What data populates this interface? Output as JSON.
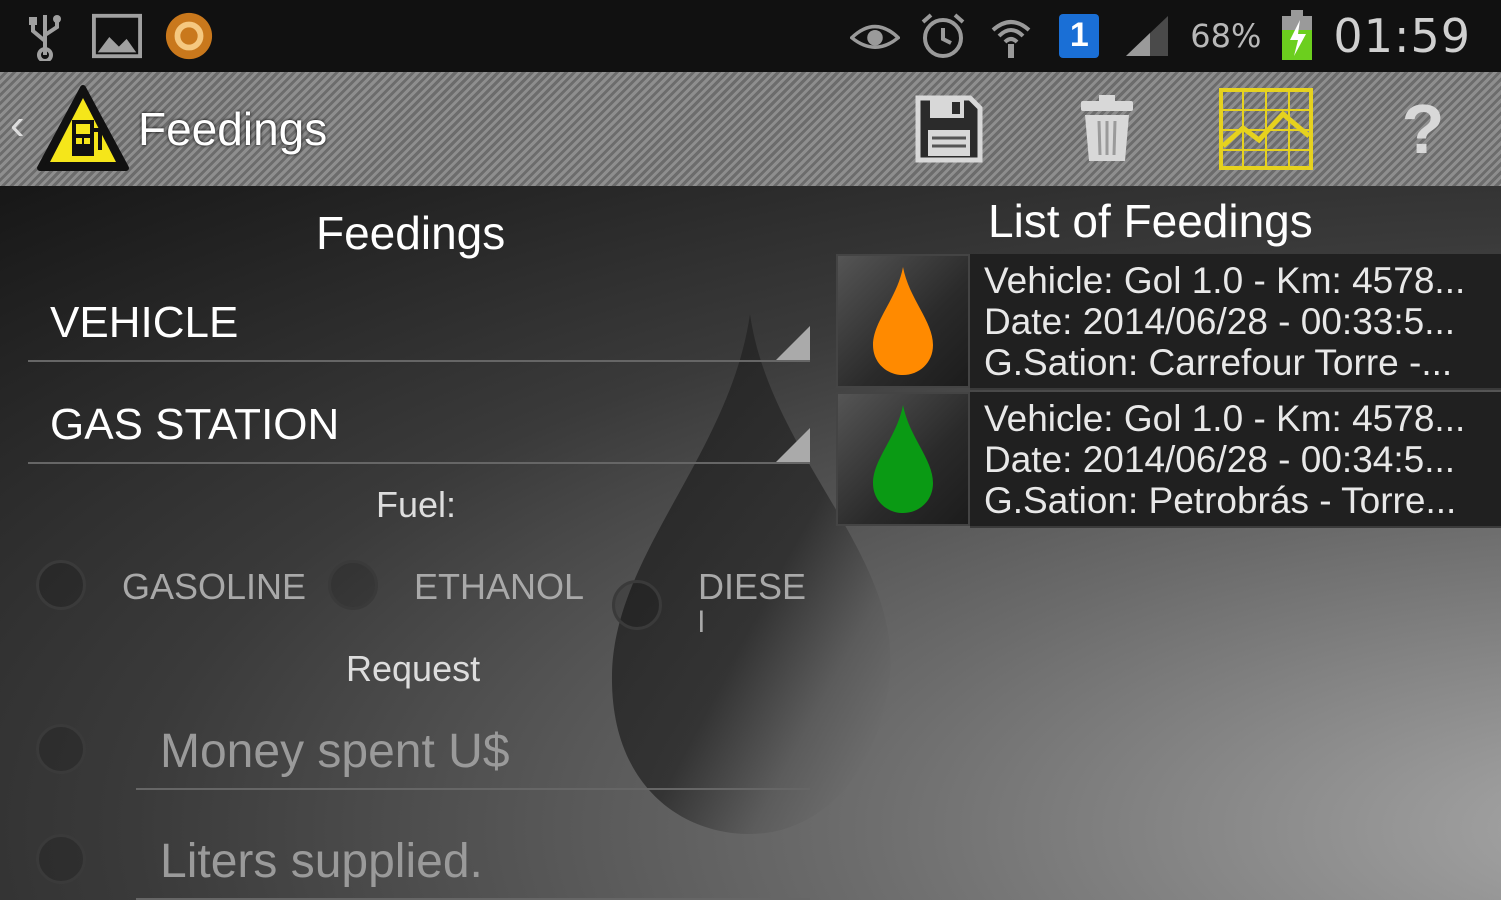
{
  "status_bar": {
    "left_icons": [
      "usb-icon",
      "picture-icon",
      "app-notification-icon"
    ],
    "right_icons": [
      "eye-icon",
      "alarm-icon",
      "wifi-icon",
      "notification-one-icon",
      "signal-icon",
      "battery-charging-icon"
    ],
    "notification_count": "1",
    "battery": "68%",
    "clock": "01:59"
  },
  "action_bar": {
    "title": "Feedings",
    "actions": [
      "save-icon",
      "trash-icon",
      "chart-icon",
      "help-icon"
    ],
    "help_glyph": "?",
    "chart_color": "#e6d21e"
  },
  "form": {
    "title": "Feedings",
    "vehicle_label": "VEHICLE",
    "gas_station_label": "GAS STATION",
    "fuel_label": "Fuel:",
    "fuel_options": [
      "GASOLINE",
      "ETHANOL",
      "DIESE"
    ],
    "diesel_wrap": "l",
    "request_label": "Request",
    "money_placeholder": "Money spent U$",
    "liters_placeholder": "Liters supplied."
  },
  "list": {
    "title": "List of Feedings",
    "items": [
      {
        "line1": "Vehicle: Gol 1.0 - Km: 4578...",
        "line2": "Date: 2014/06/28 - 00:33:5...",
        "line3": "G.Sation: Carrefour Torre -...",
        "drop_color": "#ff8a00"
      },
      {
        "line1": "Vehicle: Gol 1.0 - Km: 4578...",
        "line2": "Date: 2014/06/28 - 00:34:5...",
        "line3": "G.Sation: Petrobrás - Torre...",
        "drop_color": "#0a9a14"
      }
    ]
  }
}
